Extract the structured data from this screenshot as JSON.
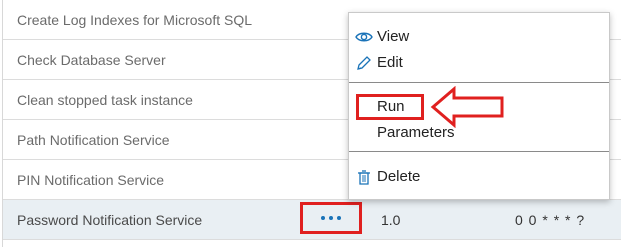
{
  "table": {
    "rows": [
      {
        "name": "Create Log Indexes for Microsoft SQL",
        "version": "",
        "schedule": ""
      },
      {
        "name": "Check Database Server",
        "version": "",
        "schedule": ""
      },
      {
        "name": "Clean stopped task instance",
        "version": "",
        "schedule": ""
      },
      {
        "name": "Path Notification Service",
        "version": "",
        "schedule": ""
      },
      {
        "name": "PIN Notification Service",
        "version": "",
        "schedule": ""
      },
      {
        "name": "Password Notification Service",
        "version": "1.0",
        "schedule": "0 0 * * * ?"
      }
    ]
  },
  "context_menu": {
    "view_label": "View",
    "edit_label": "Edit",
    "run_label": "Run",
    "parameters_label": "Parameters",
    "delete_label": "Delete"
  },
  "colors": {
    "highlight_red": "#e0201f",
    "accent_blue": "#1a73b8",
    "selected_row": "#e9eff3"
  },
  "icons": {
    "view": "eye-icon",
    "edit": "pencil-icon",
    "delete": "trash-icon",
    "actions": "more-horizontal-icon",
    "annotation": "left-arrow-icon"
  }
}
